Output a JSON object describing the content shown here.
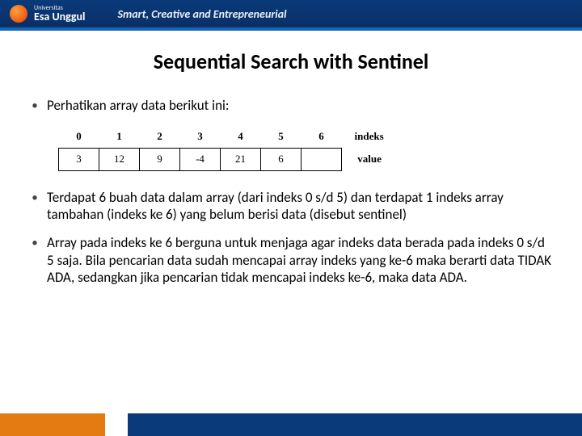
{
  "header": {
    "univ_small": "Universitas",
    "univ_name": "Esa Unggul",
    "tagline": "Smart, Creative and Entrepreneurial"
  },
  "title": "Sequential Search with Sentinel",
  "bullets": {
    "b1": "Perhatikan array data berikut ini:",
    "b2": "Terdapat 6 buah data dalam array (dari indeks 0 s/d 5) dan terdapat 1 indeks array tambahan (indeks ke 6) yang belum berisi data (disebut sentinel)",
    "b3": "Array pada indeks ke 6 berguna untuk menjaga agar indeks data berada pada indeks 0 s/d 5 saja.  Bila pencarian data sudah mencapai array indeks yang ke-6 maka berarti data TIDAK ADA, sedangkan jika pencarian tidak mencapai indeks ke-6, maka data ADA."
  },
  "array": {
    "index_label": "indeks",
    "value_label": "value",
    "indices": [
      "0",
      "1",
      "2",
      "3",
      "4",
      "5",
      "6"
    ],
    "values": [
      "3",
      "12",
      "9",
      "-4",
      "21",
      "6",
      ""
    ]
  }
}
